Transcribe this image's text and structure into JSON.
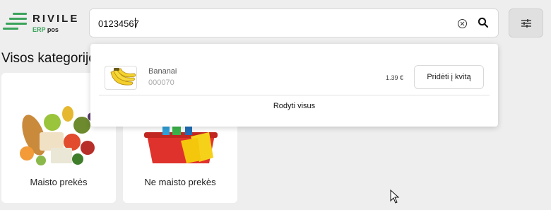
{
  "header": {
    "logo": {
      "brand": "RIVILE",
      "sub_erp": "ERP",
      "sub_pos": "pos",
      "accent_color": "#3aa35b"
    },
    "search": {
      "value": "01234567",
      "clear_icon": "close-circle-icon",
      "search_icon": "search-icon"
    },
    "filter_icon": "sliders-icon"
  },
  "page": {
    "title": "Visos kategorijos"
  },
  "categories": [
    {
      "label": "Maisto prekės",
      "icon": "groceries-image"
    },
    {
      "label": "Ne maisto prekės",
      "icon": "cleaning-supplies-image"
    }
  ],
  "dropdown": {
    "results": [
      {
        "name": "Bananai",
        "code": "000070",
        "price": "1.39 €",
        "add_label": "Pridėti į kvitą",
        "icon": "bananas-image"
      }
    ],
    "show_all_label": "Rodyti visus"
  }
}
